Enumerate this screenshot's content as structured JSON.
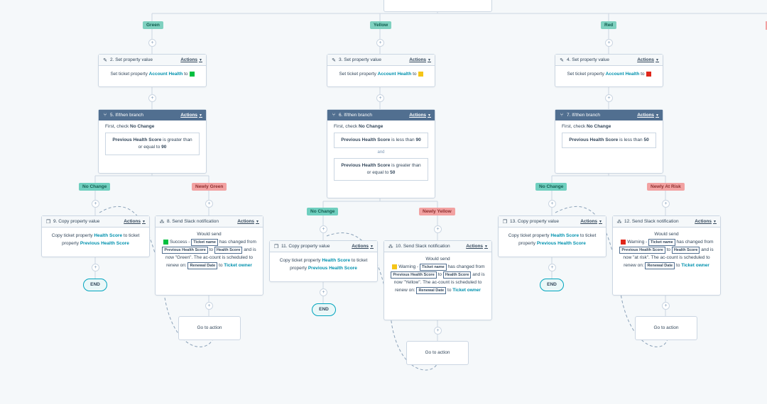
{
  "branch_tags": {
    "green": "Green",
    "yellow": "Yellow",
    "red": "Red"
  },
  "colors": {
    "green": "#00bf40",
    "yellow": "#f5c518",
    "red": "#e0271b",
    "accent": "#0091ae",
    "branch_header": "#516f90"
  },
  "common": {
    "actions": "Actions",
    "end": "END",
    "goto": "Go to action",
    "set_prefix": "Set ticket property",
    "to": "to",
    "account_health": "Account Health"
  },
  "set_cards": [
    {
      "title": "2. Set property value"
    },
    {
      "title": "3. Set property value"
    },
    {
      "title": "4. Set property value"
    }
  ],
  "branch_cards": [
    {
      "title": "5. If/then branch",
      "first_check": "First, check",
      "first_branch": "No Change",
      "cond1": {
        "prop": "Previous Health Score",
        "op": "is greater than or equal to",
        "val": "90"
      }
    },
    {
      "title": "6. If/then branch",
      "first_check": "First, check",
      "first_branch": "No Change",
      "cond1": {
        "prop": "Previous Health Score",
        "op": "is less than",
        "val": "90"
      },
      "and": "and",
      "cond2": {
        "prop": "Previous Health Score",
        "op": "is greater than or equal to",
        "val": "50"
      }
    },
    {
      "title": "7. If/then branch",
      "first_check": "First, check",
      "first_branch": "No Change",
      "cond1": {
        "prop": "Previous Health Score",
        "op": "is less than",
        "val": "50"
      }
    }
  ],
  "outcome_tags": {
    "left_no_change": "No Change",
    "left_newly": "Newly Green",
    "mid_no_change": "No Change",
    "mid_newly": "Newly Yellow",
    "right_no_change": "No Change",
    "right_newly": "Newly At Risk"
  },
  "copy_cards": [
    {
      "title": "9. Copy property value"
    },
    {
      "title": "11. Copy property value"
    },
    {
      "title": "13. Copy property value"
    }
  ],
  "copy_text": {
    "prefix": "Copy ticket property",
    "prop1": "Health Score",
    "to": "to ticket property",
    "prop2": "Previous Health Score"
  },
  "slack_cards": [
    {
      "title": "8. Send Slack notification",
      "status": "Success -",
      "now": "and is now \"Green\". The ac-count is scheduled to renew on:"
    },
    {
      "title": "10. Send Slack notification",
      "status": "Warning -",
      "now": "and is now \"Yellow\". The ac-count is scheduled to renew on:"
    },
    {
      "title": "12. Send Slack notification",
      "status": "Warning -",
      "now": "and is now \"at risk\". The ac-count is scheduled to renew on:"
    }
  ],
  "slack_text": {
    "would_send": "Would send",
    "ticket_name": "Ticket name",
    "has_changed": "has changed",
    "from": "from",
    "prev": "Previous Health Score",
    "to": "to",
    "health": "Health Score",
    "renewal": "Renewal Date",
    "to2": "to",
    "owner": "Ticket owner"
  }
}
